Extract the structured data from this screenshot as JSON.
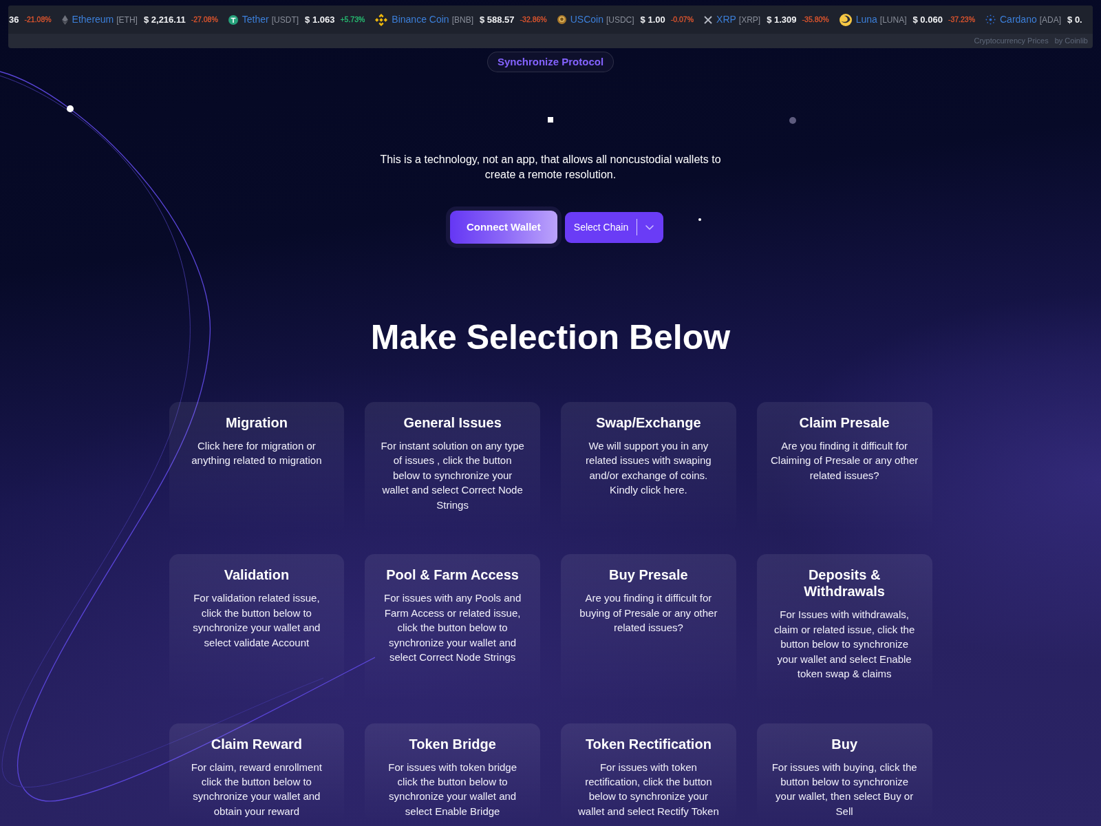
{
  "ticker": {
    "items": [
      {
        "kind": "plain",
        "price": "36",
        "change": "-21.08%",
        "color": "#e4572e"
      },
      {
        "kind": "diamond",
        "name": "Ethereum",
        "symbol": "[ETH]",
        "price": "$ 2,216.11",
        "change": "-27.08%",
        "color": "#e4572e"
      },
      {
        "kind": "tcoin",
        "name": "Tether",
        "symbol": "[USDT]",
        "price": "$ 1.063",
        "change": "+5.73%",
        "color": "#27c274"
      },
      {
        "kind": "cluster",
        "name": "Binance Coin",
        "symbol": "[BNB]",
        "price": "$ 588.57",
        "change": "-32.86%",
        "color": "#e4572e"
      },
      {
        "kind": "goldcoin",
        "name": "USCoin",
        "symbol": "[USDC]",
        "price": "$ 1.00",
        "change": "-0.07%",
        "color": "#e4572e"
      },
      {
        "kind": "cross",
        "name": "XRP",
        "symbol": "[XRP]",
        "price": "$ 1.309",
        "change": "-35.80%",
        "color": "#e4572e"
      },
      {
        "kind": "crescent",
        "name": "Luna",
        "symbol": "[LUNA]",
        "price": "$ 0.060",
        "change": "-37.23%",
        "color": "#e4572e"
      },
      {
        "kind": "sunburst",
        "name": "Cardano",
        "symbol": "[ADA]",
        "price": "$ 0."
      }
    ],
    "credit": [
      "Cryptocurrency Prices",
      "by Coinlib"
    ]
  },
  "hero": {
    "badge": "Synchronize Protocol",
    "description": "This is a technology, not an app, that allows all noncustodial wallets to create a remote resolution.",
    "connect_button": "Connect Wallet",
    "chain_select": "Select Chain"
  },
  "section": {
    "title": "Make Selection Below",
    "cards": [
      {
        "title": "Migration",
        "description": "Click here for migration or anything related to migration"
      },
      {
        "title": "General Issues",
        "description": "For instant solution on any type of issues , click the button below to synchronize your wallet and select Correct Node Strings"
      },
      {
        "title": "Swap/Exchange",
        "description": "We will support you in any related issues with swaping and/or exchange of coins. Kindly click here."
      },
      {
        "title": "Claim Presale",
        "description": "Are you finding it difficult for Claiming of Presale or any other related issues?"
      },
      {
        "title": "Validation",
        "description": "For validation related issue, click the button below to synchronize your wallet and select validate Account"
      },
      {
        "title": "Pool & Farm Access",
        "description": "For issues with any Pools and Farm Access or related issue, click the button below to synchronize your wallet and select Correct Node Strings"
      },
      {
        "title": "Buy Presale",
        "description": "Are you finding it difficult for buying of Presale or any other related issues?"
      },
      {
        "title": "Deposits & Withdrawals",
        "description": "For Issues with withdrawals, claim or related issue, click the button below to synchronize your wallet and select Enable token swap & claims"
      },
      {
        "title": "Claim Reward",
        "description": "For claim, reward enrollment click the button below to synchronize your wallet and obtain your reward"
      },
      {
        "title": "Token Bridge",
        "description": "For issues with token bridge click the button below to synchronize your wallet and select Enable Bridge"
      },
      {
        "title": "Token Rectification",
        "description": "For issues with token rectification, click the button below to synchronize your wallet and select Rectify Token"
      },
      {
        "title": "Buy",
        "description": "For issues with buying, click the button below to synchronize your wallet, then select Buy or Sell"
      }
    ]
  }
}
